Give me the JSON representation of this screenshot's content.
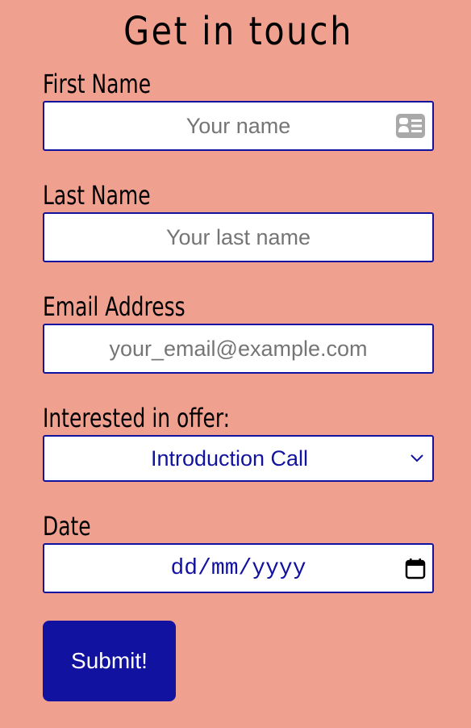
{
  "form": {
    "title": "Get in touch",
    "first_name": {
      "label": "First Name",
      "placeholder": "Your name",
      "icon": "contact-card-icon"
    },
    "last_name": {
      "label": "Last Name",
      "placeholder": "Your last name"
    },
    "email": {
      "label": "Email Address",
      "placeholder": "your_email@example.com"
    },
    "offer": {
      "label": "Interested in offer:",
      "selected": "Introduction Call",
      "icon": "chevron-down-icon"
    },
    "date": {
      "label": "Date",
      "placeholder": "dd/mm/yyyy",
      "icon": "calendar-icon"
    },
    "submit_label": "Submit!"
  },
  "colors": {
    "background": "#f0a08f",
    "accent": "#1212a0",
    "field_background": "#ffffff",
    "placeholder": "#757575"
  }
}
